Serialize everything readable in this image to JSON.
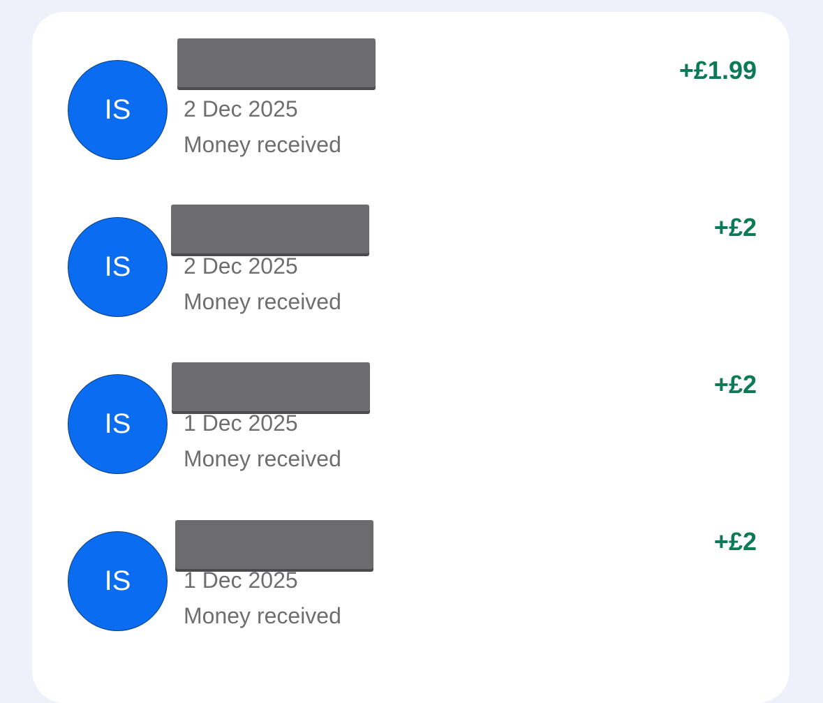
{
  "transactions": [
    {
      "initials": "IS",
      "date": "2 Dec 2025",
      "type": "Money received",
      "amount": "+£1.99"
    },
    {
      "initials": "IS",
      "date": "2 Dec 2025",
      "type": "Money received",
      "amount": "+£2"
    },
    {
      "initials": "IS",
      "date": "1 Dec 2025",
      "type": "Money received",
      "amount": "+£2"
    },
    {
      "initials": "IS",
      "date": "1 Dec 2025",
      "type": "Money received",
      "amount": "+£2"
    }
  ],
  "colors": {
    "avatar": "#0a6cf0",
    "amount_positive": "#0b7a55",
    "secondary_text": "#6e6e70",
    "background": "#eef1f9"
  }
}
